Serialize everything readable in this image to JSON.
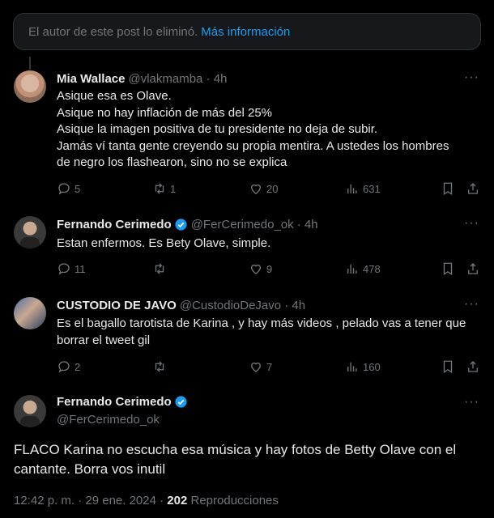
{
  "banner": {
    "text": "El autor de este post lo eliminó.",
    "link": "Más información"
  },
  "replies": [
    {
      "name": "Mia Wallace",
      "handle": "@vlakmamba · 4h",
      "verified": false,
      "lines": [
        "Asique esa es Olave.",
        "Asique no hay inflación de más del 25%",
        "Asique la imagen positiva de tu presidente no deja de subir.",
        "Jamás ví tanta gente creyendo su propia mentira. A ustedes los hombres",
        "de negro los flashearon, sino no se explica"
      ],
      "replies": "5",
      "reposts": "1",
      "likes": "20",
      "views": "631"
    },
    {
      "name": "Fernando Cerimedo",
      "handle": "@FerCerimedo_ok · 4h",
      "verified": true,
      "lines": [
        "Estan enfermos. Es Bety Olave, simple."
      ],
      "replies": "11",
      "reposts": "",
      "likes": "9",
      "views": "478"
    },
    {
      "name": "CUSTODIO DE JAVO",
      "handle": "@CustodioDeJavo · 4h",
      "verified": false,
      "lines": [
        "Es el bagallo tarotista de Karina , y hay más videos , pelado vas a tener que",
        "borrar el tweet gil"
      ],
      "replies": "2",
      "reposts": "",
      "likes": "7",
      "views": "160"
    }
  ],
  "main": {
    "name": "Fernando Cerimedo",
    "handle": "@FerCerimedo_ok",
    "text_line1": "FLACO Karina no escucha esa música y hay fotos de Betty Olave con el",
    "text_line2": "cantante. Borra vos inutil",
    "time": "12:42 p. m. · 29 ene. 2024 ·",
    "views_count": "202",
    "views_label": "Reproducciones"
  },
  "colors": {
    "accent": "#1d9bf0",
    "muted": "#71767b",
    "text": "#e7e9ea",
    "background": "#000000"
  },
  "icons": [
    "reply-icon",
    "repost-icon",
    "like-icon",
    "views-icon",
    "bookmark-icon",
    "share-icon",
    "more-icon",
    "verified-icon"
  ]
}
